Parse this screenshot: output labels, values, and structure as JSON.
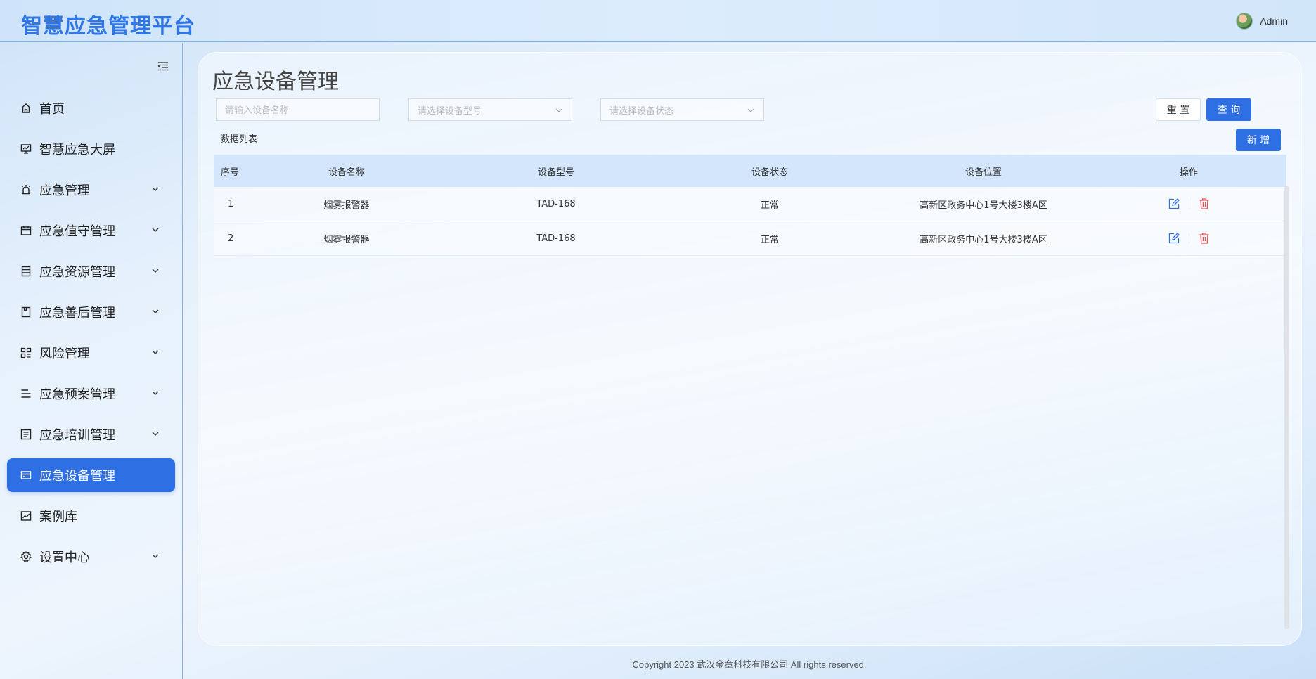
{
  "header": {
    "title": "智慧应急管理平台",
    "user_name": "Admin"
  },
  "sidebar": {
    "items": [
      {
        "label": "首页",
        "icon": "home-icon",
        "expandable": false
      },
      {
        "label": "智慧应急大屏",
        "icon": "monitor-icon",
        "expandable": false
      },
      {
        "label": "应急管理",
        "icon": "alarm-icon",
        "expandable": true
      },
      {
        "label": "应急值守管理",
        "icon": "calendar-icon",
        "expandable": true
      },
      {
        "label": "应急资源管理",
        "icon": "database-icon",
        "expandable": true
      },
      {
        "label": "应急善后管理",
        "icon": "notebook-icon",
        "expandable": true
      },
      {
        "label": "风险管理",
        "icon": "grid-icon",
        "expandable": true
      },
      {
        "label": "应急预案管理",
        "icon": "list-icon",
        "expandable": true
      },
      {
        "label": "应急培训管理",
        "icon": "document-icon",
        "expandable": true
      },
      {
        "label": "应急设备管理",
        "icon": "card-icon",
        "expandable": false,
        "active": true
      },
      {
        "label": "案例库",
        "icon": "chart-icon",
        "expandable": false
      },
      {
        "label": "设置中心",
        "icon": "gear-icon",
        "expandable": true
      }
    ]
  },
  "main": {
    "page_title": "应急设备管理",
    "filters": {
      "name_placeholder": "请输入设备名称",
      "model_placeholder": "请选择设备型号",
      "status_placeholder": "请选择设备状态"
    },
    "buttons": {
      "reset": "重 置",
      "query": "查 询",
      "add": "新 增"
    },
    "list_label": "数据列表",
    "table": {
      "columns": [
        "序号",
        "设备名称",
        "设备型号",
        "设备状态",
        "设备位置",
        "操作"
      ],
      "rows": [
        {
          "index": "1",
          "name": "烟雾报警器",
          "model": "TAD-168",
          "status": "正常",
          "location": "高新区政务中心1号大楼3楼A区"
        },
        {
          "index": "2",
          "name": "烟雾报警器",
          "model": "TAD-168",
          "status": "正常",
          "location": "高新区政务中心1号大楼3楼A区"
        }
      ]
    }
  },
  "footer": {
    "copyright": "Copyright 2023 武汉金章科技有限公司 All rights reserved."
  },
  "colors": {
    "accent": "#2f6fe4",
    "title_blue": "#2f77e6",
    "delete_red": "#e55353",
    "table_header": "#d3e6fb"
  }
}
